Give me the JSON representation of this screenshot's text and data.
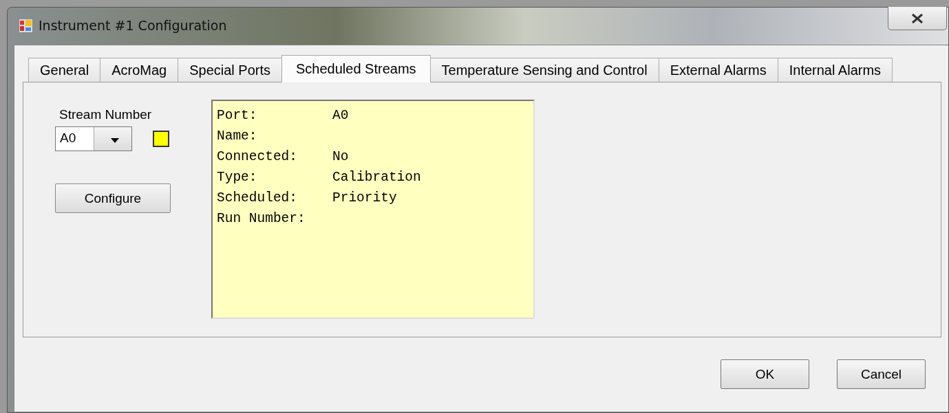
{
  "window": {
    "title": "Instrument #1 Configuration"
  },
  "tabs": [
    {
      "label": "General",
      "selected": false
    },
    {
      "label": "AcroMag",
      "selected": false
    },
    {
      "label": "Special Ports",
      "selected": false
    },
    {
      "label": "Scheduled Streams",
      "selected": true
    },
    {
      "label": "Temperature Sensing and Control",
      "selected": false
    },
    {
      "label": "External Alarms",
      "selected": false
    },
    {
      "label": "Internal Alarms",
      "selected": false
    }
  ],
  "stream": {
    "label": "Stream Number",
    "value": "A0",
    "indicator": {
      "color": "#ffff00"
    },
    "button": "Configure"
  },
  "details": [
    {
      "label": "Port:",
      "value": "A0"
    },
    {
      "label": "Name:"
    },
    {
      "label": "Connected:",
      "value": "No"
    },
    {
      "label": "Type:",
      "value": "Calibration"
    },
    {
      "label": "Scheduled:",
      "value": "Priority"
    },
    {
      "label": "Run Number:"
    }
  ],
  "buttons": [
    "OK",
    "Cancel"
  ]
}
